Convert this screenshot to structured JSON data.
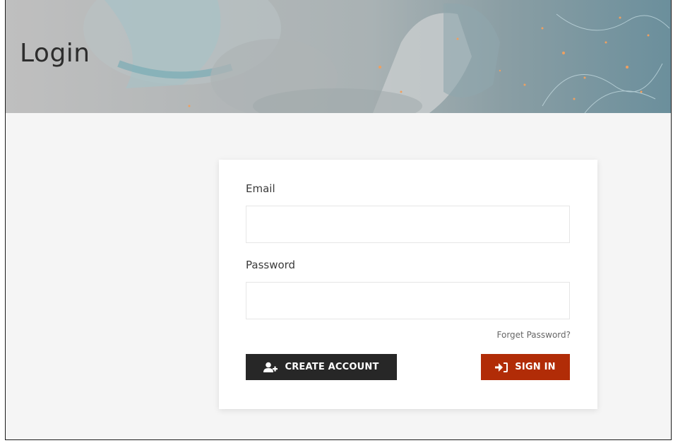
{
  "header": {
    "title": "Login"
  },
  "form": {
    "email_label": "Email",
    "email_value": "",
    "email_placeholder": "",
    "password_label": "Password",
    "password_value": "",
    "password_placeholder": "",
    "forgot_password": "Forget Password?",
    "create_account_label": "CREATE ACCOUNT",
    "sign_in_label": "SIGN IN"
  },
  "icons": {
    "create_account": "user-plus-icon",
    "sign_in": "sign-in-icon"
  },
  "colors": {
    "create_button": "#272727",
    "sign_in_button": "#b12c07",
    "page_background": "#f5f5f5"
  }
}
